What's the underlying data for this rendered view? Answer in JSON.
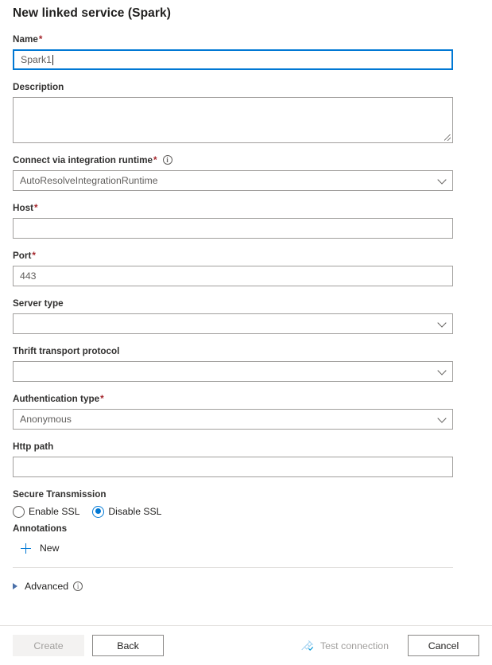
{
  "panel": {
    "title": "New linked service (Spark)"
  },
  "fields": {
    "name": {
      "label": "Name",
      "required": "*",
      "value": "Spark1",
      "placeholder": ""
    },
    "description": {
      "label": "Description",
      "value": "",
      "placeholder": ""
    },
    "integration_runtime": {
      "label": "Connect via integration runtime",
      "required": "*",
      "info_icon": "info-icon",
      "value": "AutoResolveIntegrationRuntime",
      "chevron_icon": "chevron-down-icon"
    },
    "host": {
      "label": "Host",
      "required": "*",
      "value": "",
      "placeholder": ""
    },
    "port": {
      "label": "Port",
      "required": "*",
      "value": "443",
      "placeholder": "443"
    },
    "server_type": {
      "label": "Server type",
      "value": "",
      "chevron_icon": "chevron-down-icon"
    },
    "thrift_transport_protocol": {
      "label": "Thrift transport protocol",
      "value": "",
      "chevron_icon": "chevron-down-icon"
    },
    "authentication_type": {
      "label": "Authentication type",
      "required": "*",
      "value": "Anonymous",
      "chevron_icon": "chevron-down-icon"
    },
    "http_path": {
      "label": "Http path",
      "value": "",
      "placeholder": ""
    },
    "secure_transmission": {
      "label": "Secure Transmission",
      "options": [
        {
          "label": "Enable SSL",
          "selected": false
        },
        {
          "label": "Disable SSL",
          "selected": true
        }
      ]
    },
    "annotations": {
      "label": "Annotations",
      "new_label": "New",
      "new_icon": "plus-icon"
    },
    "advanced": {
      "label": "Advanced",
      "expander_icon": "chevron-right-icon",
      "info_icon": "info-icon",
      "expanded": false
    }
  },
  "footer": {
    "create_label": "Create",
    "create_enabled": false,
    "back_label": "Back",
    "test_connection_label": "Test connection",
    "test_connection_icon": "plug-icon",
    "test_connection_enabled": false,
    "cancel_label": "Cancel"
  },
  "colors": {
    "accent": "#0078d4",
    "required_asterisk": "#a4262c",
    "border": "#a19f9d",
    "divider": "#e1dfdd",
    "disabled_text": "#a19f9d",
    "text": "#201f1e"
  }
}
